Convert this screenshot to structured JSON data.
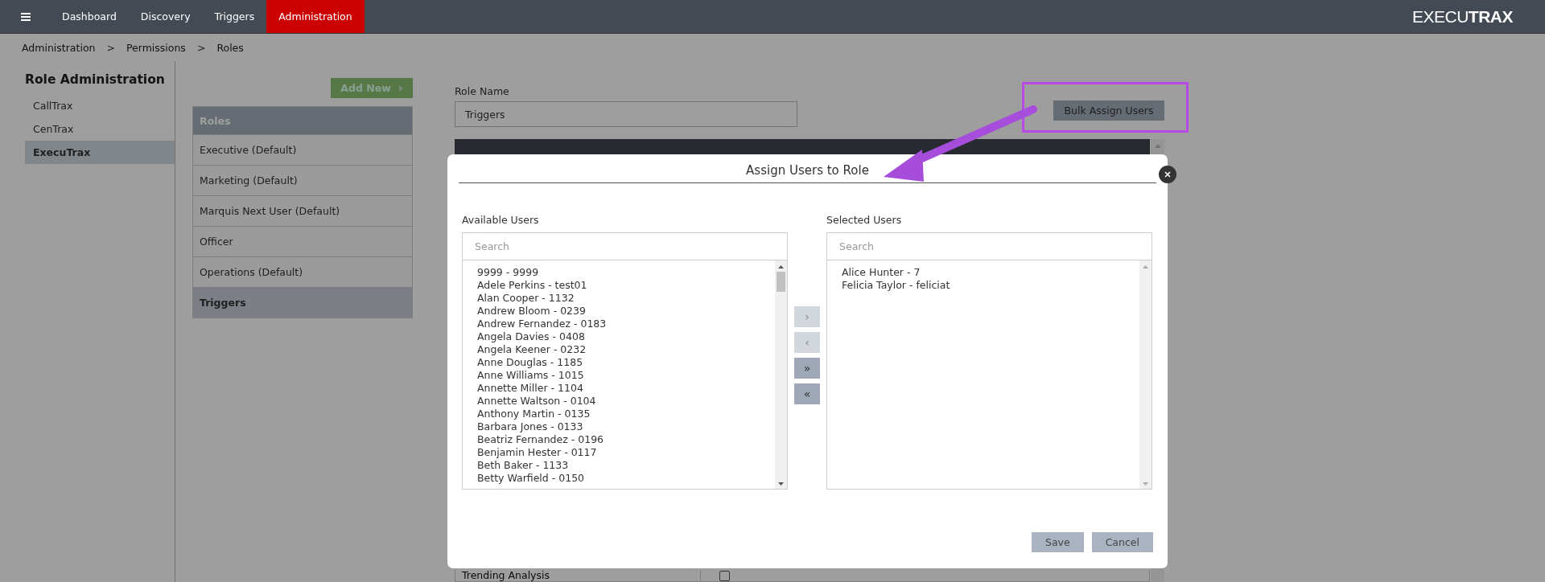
{
  "nav": {
    "tabs": [
      {
        "label": "Dashboard",
        "selected": false
      },
      {
        "label": "Discovery",
        "selected": false
      },
      {
        "label": "Triggers",
        "selected": false
      },
      {
        "label": "Administration",
        "selected": true
      }
    ],
    "logo": "EXECU**TRAX**"
  },
  "breadcrumb": [
    {
      "kind": "link",
      "text": "Administration"
    },
    {
      "kind": "sep",
      "text": ">"
    },
    {
      "kind": "link",
      "text": "Permissions"
    },
    {
      "kind": "sep",
      "text": ">"
    },
    {
      "kind": "link",
      "text": "Roles"
    }
  ],
  "sidebar": {
    "title": "Role Administration",
    "items": [
      {
        "label": "CallTrax",
        "selected": false
      },
      {
        "label": "CenTrax",
        "selected": false
      },
      {
        "label": "ExecuTrax",
        "selected": true
      }
    ]
  },
  "roles": {
    "add_button": "Add New",
    "header": "Roles",
    "items": [
      {
        "label": "Executive (Default)",
        "selected": false
      },
      {
        "label": "Marketing (Default)",
        "selected": false
      },
      {
        "label": "Marquis Next User (Default)",
        "selected": false
      },
      {
        "label": "Officer",
        "selected": false
      },
      {
        "label": "Operations (Default)",
        "selected": false
      },
      {
        "label": "Triggers",
        "selected": true
      }
    ]
  },
  "role_form": {
    "label": "Role Name",
    "value": "Triggers",
    "bulk_button": "Bulk Assign Users",
    "visible_row": {
      "label": "Trending Analysis",
      "checked": false
    }
  },
  "modal": {
    "title": "Assign Users to Role",
    "available": {
      "label": "Available Users",
      "placeholder": "Search",
      "users": [
        "9999 - 9999",
        "Adele Perkins - test01",
        "Alan Cooper - 1132",
        "Andrew Bloom - 0239",
        "Andrew Fernandez - 0183",
        "Angela Davies - 0408",
        "Angela Keener - 0232",
        "Anne Douglas - 1185",
        "Anne Williams - 1015",
        "Annette Miller - 1104",
        "Annette Waltson - 0104",
        "Anthony Martin - 0135",
        "Barbara Jones - 0133",
        "Beatriz Fernandez - 0196",
        "Benjamin Hester - 0117",
        "Beth Baker - 1133",
        "Betty Warfield - 0150"
      ]
    },
    "move_buttons": [
      {
        "symbol": "›",
        "disabled": true
      },
      {
        "symbol": "‹",
        "disabled": true
      },
      {
        "symbol": "»",
        "disabled": false
      },
      {
        "symbol": "«",
        "disabled": false
      }
    ],
    "selected": {
      "label": "Selected Users",
      "placeholder": "Search",
      "users": [
        "Alice Hunter - 7",
        "Felicia Taylor - feliciat"
      ]
    },
    "buttons": [
      "Save",
      "Cancel"
    ]
  }
}
